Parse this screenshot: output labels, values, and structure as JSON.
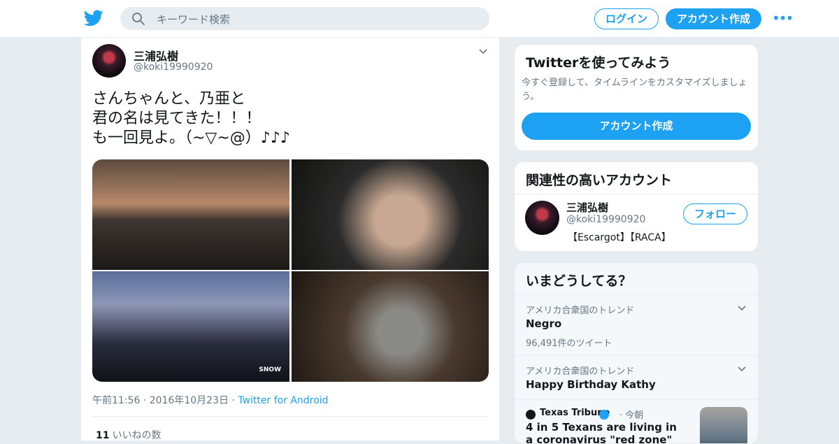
{
  "header": {
    "search_placeholder": "キーワード検索",
    "login_label": "ログイン",
    "signup_label": "アカウント作成",
    "more_label": "•••"
  },
  "tweet": {
    "author_name": "三浦弘樹",
    "author_handle": "@koki19990920",
    "text": "さんちゃんと、乃亜と\n君の名は見てきた！！！\nも一回見よ。（~▽~@）♪♪♪",
    "photo_watermark": "SNOW",
    "time": "午前11:56",
    "date": "2016年10月23日",
    "source": "Twitter for Android",
    "separator": "·",
    "like_count": "11",
    "like_label": "いいねの数"
  },
  "signup_card": {
    "title": "Twitterを使ってみよう",
    "description": "今すぐ登録して、タイムラインをカスタマイズしましょう。",
    "button_label": "アカウント作成"
  },
  "related_card": {
    "title": "関連性の高いアカウント",
    "account_name": "三浦弘樹",
    "account_handle": "@koki19990920",
    "account_bio": "【Escargot】【RACA】",
    "follow_label": "フォロー"
  },
  "trends_card": {
    "title": "いまどうしてる？",
    "trends": [
      {
        "context": "アメリカ合衆国のトレンド",
        "name": "Negro",
        "count": "96,491件のツイート"
      },
      {
        "context": "アメリカ合衆国のトレンド",
        "name": "Happy Birthday Kathy"
      }
    ],
    "news": {
      "source": "Texas Tribune",
      "separator": "·",
      "time": "今朝",
      "headline": "4 in 5 Texans are living in a coronavirus \"red zone\""
    }
  },
  "colors": {
    "brand": "#1da1f2",
    "background": "#e6ecf0",
    "text": "#14171a",
    "secondary_text": "#657786"
  }
}
